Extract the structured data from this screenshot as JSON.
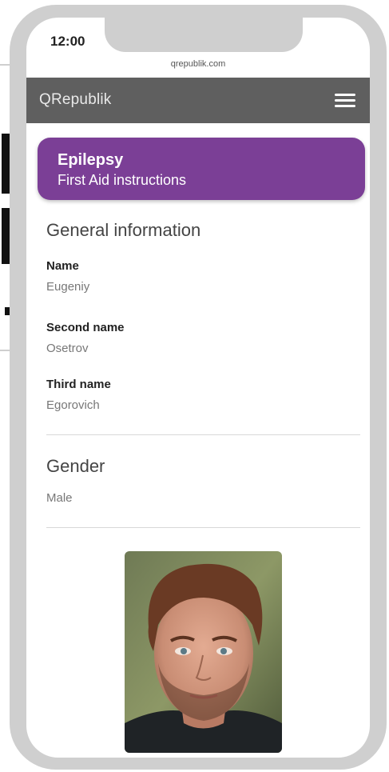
{
  "status_bar": {
    "time": "12:00"
  },
  "browser": {
    "url": "qrepublik.com"
  },
  "app_bar": {
    "title": "QRepublik"
  },
  "banner": {
    "title": "Epilepsy",
    "subtitle": "First Aid instructions"
  },
  "general": {
    "heading": "General information",
    "fields": [
      {
        "label": "Name",
        "value": "Eugeniy"
      },
      {
        "label": "Second name",
        "value": "Osetrov"
      },
      {
        "label": "Third name",
        "value": "Egorovich"
      }
    ]
  },
  "gender": {
    "heading": "Gender",
    "value": "Male"
  },
  "icons": {
    "menu": "hamburger-menu-icon"
  },
  "colors": {
    "banner": "#7b3f96",
    "app_bar": "#5f5f5f",
    "frame": "#cfcfcf"
  }
}
